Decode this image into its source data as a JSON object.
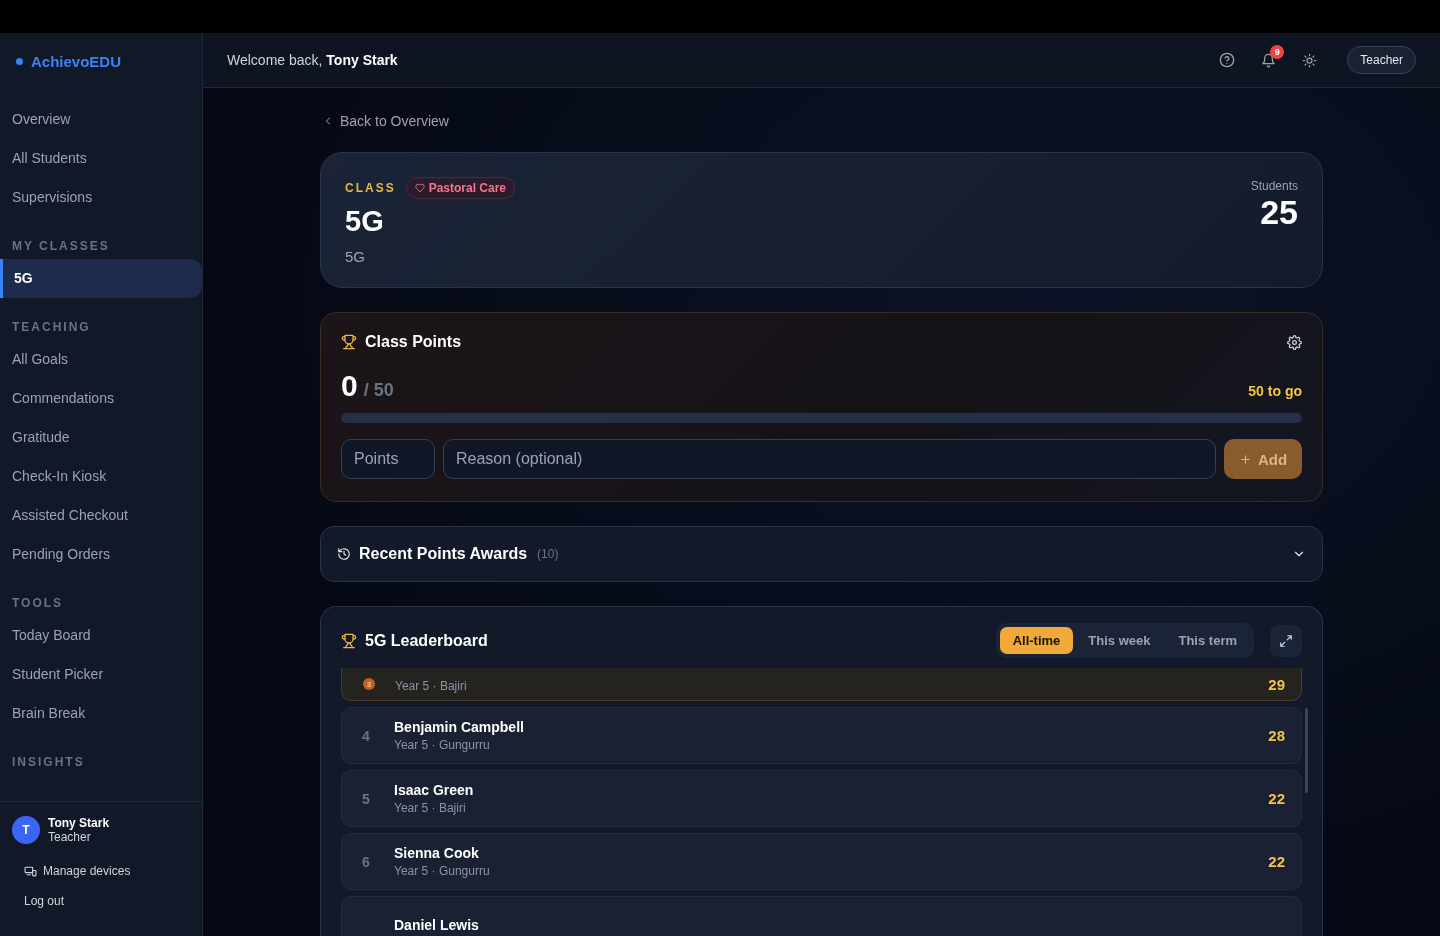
{
  "brand": {
    "name": "AchievoEDU"
  },
  "sidebar": {
    "sections": [
      {
        "items": [
          {
            "label": "Overview",
            "selected": false
          },
          {
            "label": "All Students",
            "selected": false
          },
          {
            "label": "Supervisions",
            "selected": false
          }
        ]
      },
      {
        "heading": "MY CLASSES",
        "items": [
          {
            "label": "5G",
            "selected": true
          }
        ]
      },
      {
        "heading": "TEACHING",
        "items": [
          {
            "label": "All Goals",
            "selected": false
          },
          {
            "label": "Commendations",
            "selected": false
          },
          {
            "label": "Gratitude",
            "selected": false
          },
          {
            "label": "Check-In Kiosk",
            "selected": false
          },
          {
            "label": "Assisted Checkout",
            "selected": false
          },
          {
            "label": "Pending Orders",
            "selected": false
          }
        ]
      },
      {
        "heading": "TOOLS",
        "items": [
          {
            "label": "Today Board",
            "selected": false
          },
          {
            "label": "Student Picker",
            "selected": false
          },
          {
            "label": "Brain Break",
            "selected": false
          }
        ]
      },
      {
        "heading": "INSIGHTS"
      }
    ],
    "user": {
      "initial": "T",
      "name": "Tony Stark",
      "role": "Teacher"
    },
    "links": [
      {
        "kind": "devices",
        "label": "Manage devices"
      },
      {
        "kind": "plain",
        "label": "Log out"
      }
    ]
  },
  "header": {
    "greeting": "Welcome back, **Tony Stark**",
    "notifications": "9",
    "role_button": "Teacher"
  },
  "back_link": "Back to Overview",
  "class_card": {
    "label": "CLASS",
    "tag": "Pastoral Care",
    "name": "5G",
    "subtitle": "5G",
    "stat_label": "Students",
    "stat_value": "25"
  },
  "class_points": {
    "title": "Class Points",
    "current": "0",
    "target": "/ 50",
    "remaining": "50 to go",
    "points_placeholder": "Points",
    "reason_placeholder": "Reason (optional)",
    "add_button": "Add"
  },
  "recent_awards": {
    "title": "Recent Points Awards",
    "count": "(10)",
    "expanded": false
  },
  "leaderboard": {
    "title": "5G Leaderboard",
    "tabs": [
      {
        "label": "All-time",
        "selected": true
      },
      {
        "label": "This week",
        "selected": false
      },
      {
        "label": "This term",
        "selected": false
      }
    ],
    "rows": [
      {
        "kind": "medal",
        "rank": "3",
        "meta": "Year 5 · Bajiri",
        "score": "29"
      },
      {
        "kind": "plain",
        "rank": "4",
        "name": "Benjamin Campbell",
        "meta": "Year 5 · Gungurru",
        "score": "28"
      },
      {
        "kind": "plain",
        "rank": "5",
        "name": "Isaac Green",
        "meta": "Year 5 · Bajiri",
        "score": "22"
      },
      {
        "kind": "plain",
        "rank": "6",
        "name": "Sienna Cook",
        "meta": "Year 5 · Gungurru",
        "score": "22"
      },
      {
        "kind": "plain",
        "name": "Daniel Lewis"
      }
    ]
  }
}
